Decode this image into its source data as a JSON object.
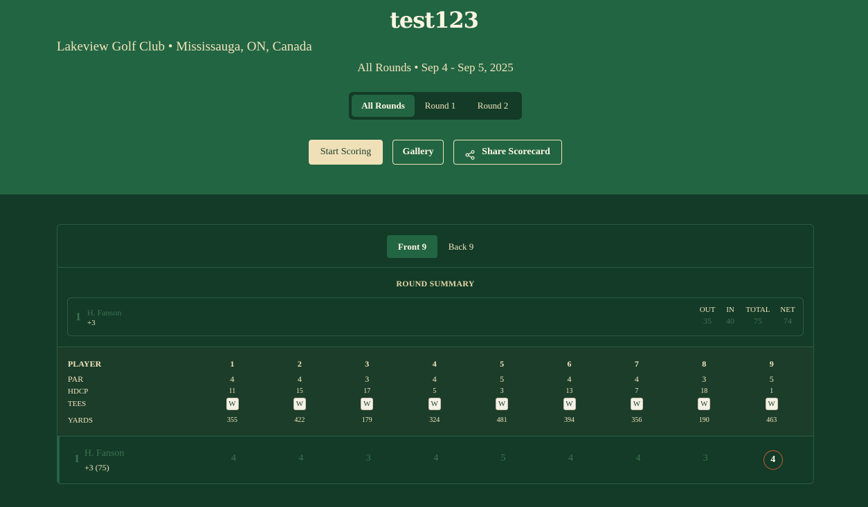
{
  "header": {
    "title": "test123",
    "venue": "Lakeview Golf Club • Mississauga, ON, Canada",
    "dates": "All Rounds • Sep 4 - Sep 5, 2025"
  },
  "round_tabs": [
    {
      "label": "All Rounds",
      "active": true
    },
    {
      "label": "Round 1",
      "active": false
    },
    {
      "label": "Round 2",
      "active": false
    }
  ],
  "actions": {
    "start_scoring": "Start Scoring",
    "gallery": "Gallery",
    "share": "Share Scorecard",
    "share_icon": "share-icon"
  },
  "nine_tabs": [
    {
      "label": "Front 9",
      "active": true
    },
    {
      "label": "Back 9",
      "active": false
    }
  ],
  "summary": {
    "title": "ROUND SUMMARY",
    "headers": [
      "OUT",
      "IN",
      "TOTAL",
      "NET"
    ],
    "player": {
      "rank": "1",
      "name": "H. Fanson",
      "to_par": "+3",
      "values": [
        "35",
        "40",
        "75",
        "74"
      ]
    }
  },
  "scorecard": {
    "labels": {
      "player": "PLAYER",
      "par": "PAR",
      "hdcp": "HDCP",
      "tees": "TEES",
      "yards": "YARDS"
    },
    "holes": [
      "1",
      "2",
      "3",
      "4",
      "5",
      "6",
      "7",
      "8",
      "9"
    ],
    "par": [
      "4",
      "4",
      "3",
      "4",
      "5",
      "4",
      "4",
      "3",
      "5"
    ],
    "hdcp": [
      "11",
      "15",
      "17",
      "5",
      "3",
      "13",
      "7",
      "18",
      "1"
    ],
    "tees": [
      "W",
      "W",
      "W",
      "W",
      "W",
      "W",
      "W",
      "W",
      "W"
    ],
    "yards": [
      "355",
      "422",
      "179",
      "324",
      "481",
      "394",
      "356",
      "190",
      "463"
    ]
  },
  "player_row": {
    "rank": "1",
    "name": "H. Fanson",
    "subtitle": "+3 (75)",
    "scores": [
      "4",
      "4",
      "3",
      "4",
      "5",
      "4",
      "4",
      "3",
      "4"
    ],
    "highlighted_hole_index": 8
  },
  "colors": {
    "hero_green": "#226542",
    "dark_green": "#133b27",
    "cream": "#f0e3bb",
    "bogey_ring": "#c45c3a"
  }
}
